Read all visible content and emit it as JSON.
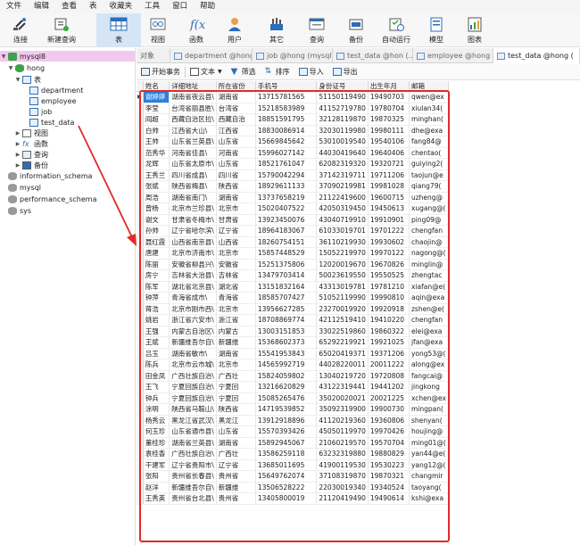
{
  "menu": [
    "文件",
    "编辑",
    "查看",
    "表",
    "收藏夹",
    "工具",
    "窗口",
    "帮助"
  ],
  "toolbar": {
    "connect": "连接",
    "new_query": "新建查询",
    "table": "表",
    "view": "视图",
    "function": "函数",
    "user": "用户",
    "other": "其它",
    "query": "查询",
    "backup": "备份",
    "automation": "自动运行",
    "model": "模型",
    "chart": "图表"
  },
  "tree": {
    "conn": "mysql8",
    "db": "hong",
    "tables_folder": "表",
    "tables": [
      "department",
      "employee",
      "job",
      "test_data"
    ],
    "views": "视图",
    "functions": "函数",
    "queries": "查询",
    "backups": "备份",
    "other_dbs": [
      "information_schema",
      "mysql",
      "performance_schema",
      "sys"
    ]
  },
  "tabs": [
    "对象",
    "department @hong (mysql...",
    "job @hong (mysql...",
    "test_data @hon (...",
    "employee @hong ...",
    "test_data @hong ("
  ],
  "table_toolbar": {
    "begin_tx": "开始事务",
    "text": "文本",
    "filter": "筛选",
    "sort": "排序",
    "import": "导入",
    "export": "导出"
  },
  "columns": [
    "姓名",
    "详细地址",
    "所在省份",
    "手机号",
    "身份证号",
    "出生年月",
    "邮箱"
  ],
  "rows": [
    [
      "谢婷婷",
      "湖南省夜云县\\",
      "湖南省",
      "13715781565",
      "51150119490",
      "19490703",
      "qwen@ex"
    ],
    [
      "李莹",
      "台湾省丽县胜\\",
      "台湾省",
      "15218583989",
      "41152719780",
      "19780704",
      "xiulan34("
    ],
    [
      "阎超",
      "西藏自治区拉\\",
      "西藏自治",
      "18851591795",
      "32128119870",
      "19870325",
      "minghan("
    ],
    [
      "白帅",
      "江西省大山\\",
      "江西省",
      "18830086914",
      "32030119980",
      "19980111",
      "dhe@exa"
    ],
    [
      "王帅",
      "山东省兰英县\\",
      "山东省",
      "15669845642",
      "53010019540",
      "19540106",
      "fang84@"
    ],
    [
      "范秀华",
      "河南省佳县\\",
      "河南省",
      "15996027142",
      "44030419640",
      "19640406",
      "chentao("
    ],
    [
      "龙辉",
      "山东省太原市\\",
      "山东省",
      "18521761047",
      "62082319320",
      "19320721",
      "guiying2("
    ],
    [
      "王秀兰",
      "四川省成县\\",
      "四川省",
      "15790042294",
      "37142319711",
      "19711206",
      "taojun@e"
    ],
    [
      "张斌",
      "陕西省梅县\\",
      "陕西省",
      "18929611133",
      "37090219981",
      "19981028",
      "qiang79("
    ],
    [
      "周浩",
      "湖南省南门\\",
      "湖南省",
      "13737658219",
      "21122419600",
      "19600715",
      "uzheng@"
    ],
    [
      "曾杨",
      "北京市兰珍县\\",
      "北京市",
      "15020407522",
      "42050319450",
      "19450613",
      "xugang@("
    ],
    [
      "谢文",
      "甘肃省冬梅市\\",
      "甘肃省",
      "13923450076",
      "43040719910",
      "19910901",
      "ping09@"
    ],
    [
      "孙帅",
      "辽宁省哈尔滨\\",
      "辽宁省",
      "18964183067",
      "61033019701",
      "19701222",
      "chengfan"
    ],
    [
      "聂红霞",
      "山西省南京县\\",
      "山西省",
      "18260754151",
      "36110219930",
      "19930602",
      "chaojin@"
    ],
    [
      "唐建",
      "北京市济南市\\",
      "北京市",
      "15857448529",
      "15052219970",
      "19970122",
      "nagong@("
    ],
    [
      "陈丽",
      "安徽省柳县兴\\",
      "安徽省",
      "15251375806",
      "12020019670",
      "19670826",
      "minglin@"
    ],
    [
      "房宁",
      "吉林省大治县\\",
      "吉林省",
      "13479703414",
      "50023619550",
      "19550525",
      "zhengtac"
    ],
    [
      "陈军",
      "湖北省北京县\\",
      "湖北省",
      "13151832164",
      "43313019781",
      "19781210",
      "xiafan@e("
    ],
    [
      "钟萍",
      "青海省成市\\",
      "青海省",
      "18585707427",
      "51052119990",
      "19990810",
      "aqin@exa"
    ],
    [
      "蒋浩",
      "北京市刚市西\\",
      "北京市",
      "13956627285",
      "23270019920",
      "19920918",
      "zshen@e("
    ],
    [
      "姚岩",
      "浙江省六安市\\",
      "浙江省",
      "18708869774",
      "42112519410",
      "19410220",
      "chengfan"
    ],
    [
      "王强",
      "内蒙古自治区\\",
      "内蒙古",
      "13003151853",
      "33022519860",
      "19860322",
      "elei@exa"
    ],
    [
      "王斌",
      "新疆维吾尔自\\",
      "新疆维",
      "15368602373",
      "65292219921",
      "19921025",
      "jfan@exa"
    ],
    [
      "吕玉",
      "湖南省敏市\\",
      "湖南省",
      "15541953843",
      "65020419371",
      "19371206",
      "yong53@("
    ],
    [
      "陈兵",
      "北京市云市城\\",
      "北京市",
      "14565992719",
      "44028220011",
      "20011222",
      "along@ex"
    ],
    [
      "田金凤",
      "广西壮族自治\\",
      "广西壮",
      "15824059802",
      "13040219720",
      "19720808",
      "fangcai@"
    ],
    [
      "王飞",
      "宁夏回族自治\\",
      "宁夏回",
      "13216620829",
      "43122319441",
      "19441202",
      "jingkong"
    ],
    [
      "钟兵",
      "宁夏回族自治\\",
      "宁夏回",
      "15085265476",
      "35020020021",
      "20021225",
      "xchen@ex"
    ],
    [
      "涂明",
      "陕西省马鞍山\\",
      "陕西省",
      "14719539852",
      "35092319900",
      "19900730",
      "mingpan("
    ],
    [
      "杨秀云",
      "黑龙江省武汉\\",
      "黑龙江",
      "13912918896",
      "41120219360",
      "19360806",
      "shenyan("
    ],
    [
      "何玉珍",
      "山东省通市县\\",
      "山东省",
      "15570393426",
      "45050119970",
      "19970426",
      "houjing@"
    ],
    [
      "董桂珍",
      "湖南省兰英县\\",
      "湖南省",
      "15892945067",
      "21060219570",
      "19570704",
      "ming01@("
    ],
    [
      "袁桂香",
      "广西壮族自治\\",
      "广西壮",
      "13586259118",
      "63232319880",
      "19880829",
      "yan44@e("
    ],
    [
      "干建军",
      "辽宁省贵阳市\\",
      "辽宁省",
      "13685011695",
      "41900119530",
      "19530223",
      "yang12@("
    ],
    [
      "张阳",
      "贵州省长春县\\",
      "贵州省",
      "15649762074",
      "37108319870",
      "19870321",
      "changmir"
    ],
    [
      "赵洋",
      "新疆维吾尔自\\",
      "新疆维",
      "13506528222",
      "22030019340",
      "19340524",
      "taoyang("
    ],
    [
      "王秀英",
      "贵州省台北县\\",
      "贵州省",
      "13405800019",
      "21120419490",
      "19490614",
      "kshi@exa"
    ]
  ]
}
